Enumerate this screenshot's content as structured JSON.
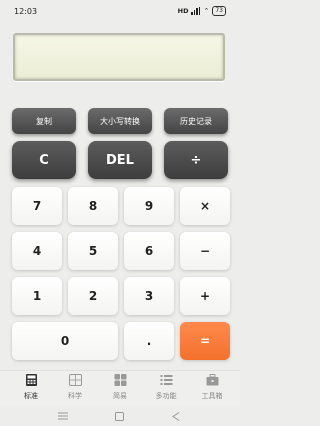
{
  "status_bar": {
    "time": "12:03",
    "network_label": "HD",
    "battery": "73"
  },
  "display": {
    "value": ""
  },
  "function_row": {
    "copy": "复制",
    "case_convert": "大小写转换",
    "history": "历史记录"
  },
  "operator_row": {
    "clear": "C",
    "delete": "DEL",
    "divide": "÷"
  },
  "keypad": {
    "k7": "7",
    "k8": "8",
    "k9": "9",
    "multiply": "×",
    "k4": "4",
    "k5": "5",
    "k6": "6",
    "minus": "−",
    "k1": "1",
    "k2": "2",
    "k3": "3",
    "plus": "+",
    "k0": "0",
    "dot": ".",
    "equals": "="
  },
  "tabs": [
    {
      "label": "标准",
      "icon": "calculator-icon",
      "active": true
    },
    {
      "label": "科学",
      "icon": "scientific-icon",
      "active": false
    },
    {
      "label": "简易",
      "icon": "grid-icon",
      "active": false
    },
    {
      "label": "多功能",
      "icon": "list-icon",
      "active": false
    },
    {
      "label": "工具箱",
      "icon": "toolbox-icon",
      "active": false
    }
  ],
  "colors": {
    "accent": "#f4712d",
    "dark_button": "#444444",
    "background": "#ededeb"
  }
}
